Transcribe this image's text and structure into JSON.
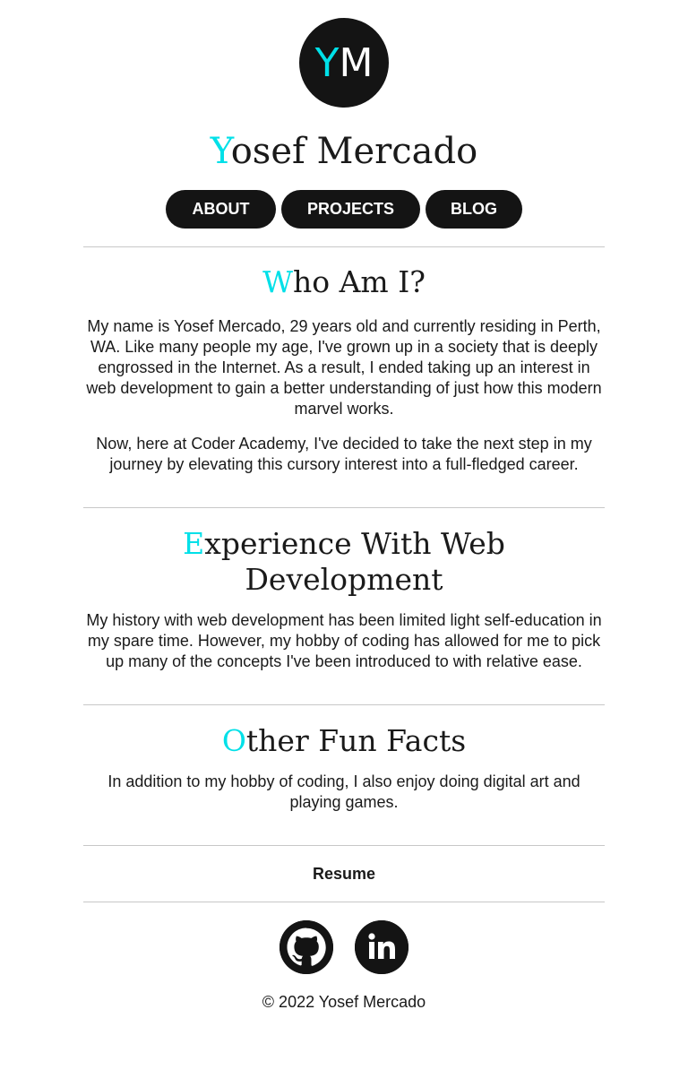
{
  "header": {
    "logo": {
      "first": "Y",
      "second": "M"
    },
    "name": {
      "accent": "Y",
      "rest": "osef Mercado"
    }
  },
  "nav": {
    "about": "ABOUT",
    "projects": "PROJECTS",
    "blog": "BLOG"
  },
  "sections": [
    {
      "title_accent": "W",
      "title_rest": "ho Am I?",
      "paragraphs": [
        "My name is Yosef Mercado, 29 years old and currently residing in Perth, WA. Like many people my age, I've grown up in a society that is deeply engrossed in the Internet. As a result, I ended taking up an interest in web development to gain a better understanding of just how this modern marvel works.",
        "Now, here at Coder Academy, I've decided to take the next step in my journey by elevating this cursory interest into a full-fledged career."
      ]
    },
    {
      "title_accent": "E",
      "title_rest": "xperience With Web Development",
      "paragraphs": [
        "My history with web development has been limited light self-education in my spare time. However, my hobby of coding has allowed for me to pick up many of the concepts I've been introduced to with relative ease."
      ]
    },
    {
      "title_accent": "O",
      "title_rest": "ther Fun Facts",
      "paragraphs": [
        "In addition to my hobby of coding, I also enjoy doing digital art and playing games."
      ]
    }
  ],
  "footer": {
    "resume": "Resume",
    "socials": [
      {
        "icon": "github-icon"
      },
      {
        "icon": "linkedin-icon"
      }
    ],
    "copyright": "© 2022 Yosef Mercado"
  },
  "colors": {
    "accent": "#00e0e8",
    "dark": "#141414",
    "text": "#1a1a1a",
    "divider": "#c8c8c8"
  }
}
